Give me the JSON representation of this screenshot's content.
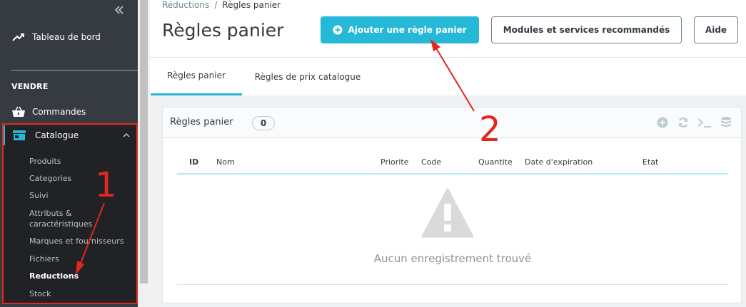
{
  "sidebar": {
    "top_item": "Tableau de bord",
    "section": "VENDRE",
    "orders": "Commandes",
    "catalog": "Catalogue",
    "sub_items": [
      "Produits",
      "Categories",
      "Suivi",
      "Attributs &",
      "caractéristiques",
      "Marques et fournisseurs",
      "Fichiers",
      "Reductions",
      "Stock"
    ]
  },
  "header": {
    "breadcrumb_parent": "Réductions",
    "breadcrumb_sep": "/",
    "breadcrumb_current": "Règles panier",
    "title": "Règles panier",
    "add_button": "Ajouter une règle panier",
    "modules_button": "Modules et services recommandés",
    "help_button": "Aide"
  },
  "tabs": [
    "Règles panier",
    "Règles de prix catalogue"
  ],
  "panel": {
    "title": "Règles panier",
    "count": "0",
    "columns": [
      "ID",
      "Nom",
      "Priorite",
      "Code",
      "Quantite",
      "Date d'expiration",
      "Etat"
    ],
    "empty_message": "Aucun enregistrement trouvé"
  },
  "annotations": {
    "step1": "1",
    "step2": "2",
    "color": "#e2271d"
  },
  "colors": {
    "accent": "#25b9d7",
    "sidebar": "#363a41",
    "sidebar_active": "#202226"
  }
}
